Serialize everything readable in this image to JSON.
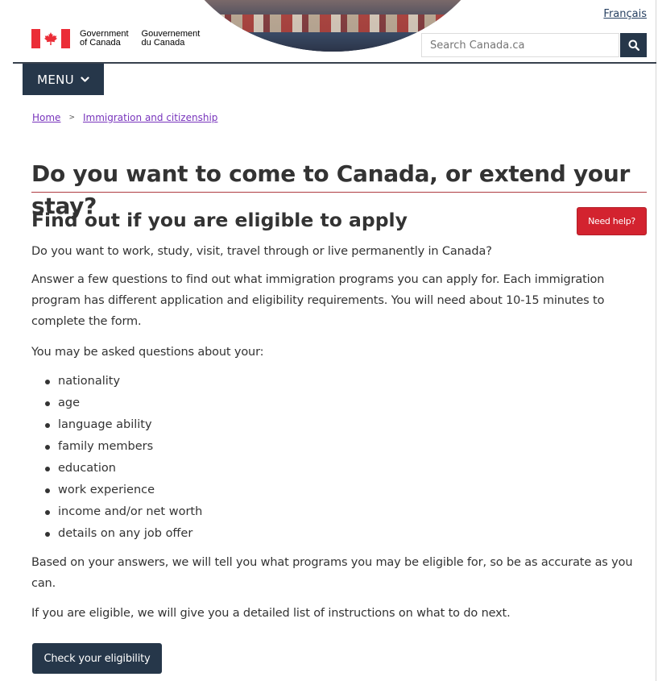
{
  "header": {
    "language_link": "Français",
    "gov_en_line1": "Government",
    "gov_en_line2": "of Canada",
    "gov_fr_line1": "Gouvernement",
    "gov_fr_line2": "du Canada",
    "search_placeholder": "Search Canada.ca",
    "search_icon": "search-icon",
    "flag_icon": "maple-leaf-icon"
  },
  "menu": {
    "label": "MENU",
    "icon": "chevron-down-icon"
  },
  "breadcrumb": {
    "items": [
      "Home",
      "Immigration and citizenship"
    ],
    "separator": ">"
  },
  "main": {
    "title": "Do you want to come to Canada, or extend your stay?",
    "subtitle": "Find out if you are eligible to apply",
    "help_button": "Need help?",
    "intro": "Do you want to work, study, visit, travel through or live permanently in Canada?",
    "description": "Answer a few questions to find out what immigration programs you can apply for. Each immigration program has different application and eligibility requirements. You will need about 10-15 minutes to complete the form.",
    "questions_intro": "You may be asked questions about your:",
    "question_topics": [
      "nationality",
      "age",
      "language ability",
      "family members",
      "education",
      "work experience",
      "income and/or net worth",
      "details on any job offer"
    ],
    "accuracy_note": "Based on your answers, we will tell you what programs you may be eligible for, so be as accurate as you can.",
    "next_steps": "If you are eligible, we will give you a detailed list of instructions on what to do next.",
    "check_button": "Check your eligibility"
  },
  "colors": {
    "navy": "#26374a",
    "red": "#d3232f",
    "flag_red": "#eb2d37",
    "visited_link": "#7834bc",
    "title_rule": "#af3c43"
  }
}
